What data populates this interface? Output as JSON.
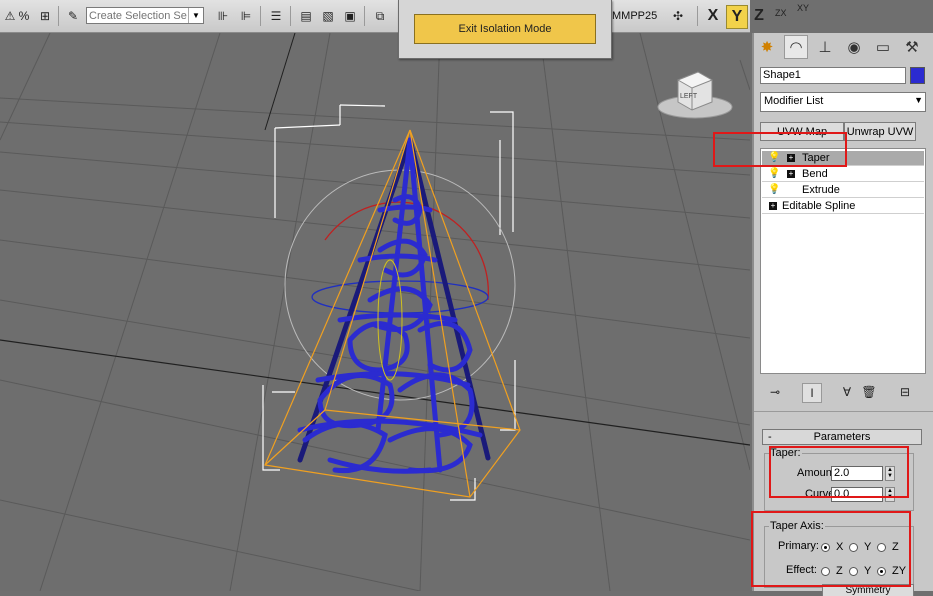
{
  "toolbar": {
    "selection_set_placeholder": "Create Selection Se",
    "named_selection": "MMPP25",
    "axis_x": "X",
    "axis_y": "Y",
    "axis_z": "Z",
    "plane_zx": "ZX",
    "plane_xy": "XY",
    "active_axis": "Y",
    "icons": [
      "select-icon",
      "percent-snap-icon",
      "spinner-snap-icon",
      "edit-named-selection-icon",
      "mirror-icon",
      "align-icon",
      "layer-manager-icon",
      "graphite-toggle-icon",
      "curve-editor-icon",
      "schematic-view-icon",
      "material-editor-icon",
      "render-setup-icon",
      "snowflake-icon"
    ]
  },
  "isolation": {
    "button_label": "Exit Isolation Mode",
    "button_color": "#f0c64a"
  },
  "viewport": {
    "viewcube_label": "LEFT",
    "object_color": "#2b2bd0",
    "gizmo_color": "#f0a020"
  },
  "panel": {
    "tabs": [
      "create-icon",
      "modify-icon",
      "hierarchy-icon",
      "motion-icon",
      "display-icon",
      "utilities-icon"
    ],
    "active_tab": "modify-icon",
    "object_name": "Shape1",
    "object_color": "#2b2bd0",
    "modifier_list_label": "Modifier List",
    "buttons": {
      "uvw_map": "UVW Map",
      "unwrap_uvw": "Unwrap UVW"
    },
    "stack": [
      {
        "label": "Taper",
        "selected": true,
        "has_bulb": true,
        "has_plus": true
      },
      {
        "label": "Bend",
        "selected": false,
        "has_bulb": true,
        "has_plus": true
      },
      {
        "label": "Extrude",
        "selected": false,
        "has_bulb": true,
        "has_plus": false
      },
      {
        "label": "Editable Spline",
        "selected": false,
        "has_bulb": false,
        "has_plus": true
      }
    ],
    "stack_tools": [
      "pin-stack-icon",
      "show-end-result-icon",
      "make-unique-icon",
      "remove-modifier-icon",
      "configure-modifier-sets-icon"
    ],
    "rollout": {
      "collapse_symbol": "-",
      "title": "Parameters",
      "taper_group": "Taper:",
      "amount_label": "Amount:",
      "amount_value": "2.0",
      "curve_label": "Curve:",
      "curve_value": "0.0",
      "axis_group": "Taper Axis:",
      "primary_label": "Primary:",
      "primary_options": [
        "X",
        "Y",
        "Z"
      ],
      "primary_selected": "X",
      "effect_label": "Effect:",
      "effect_options": [
        "Z",
        "Y",
        "ZY"
      ],
      "effect_selected": "ZY",
      "symmetry_label": "Symmetry"
    }
  },
  "annotation_color": "#e01818"
}
